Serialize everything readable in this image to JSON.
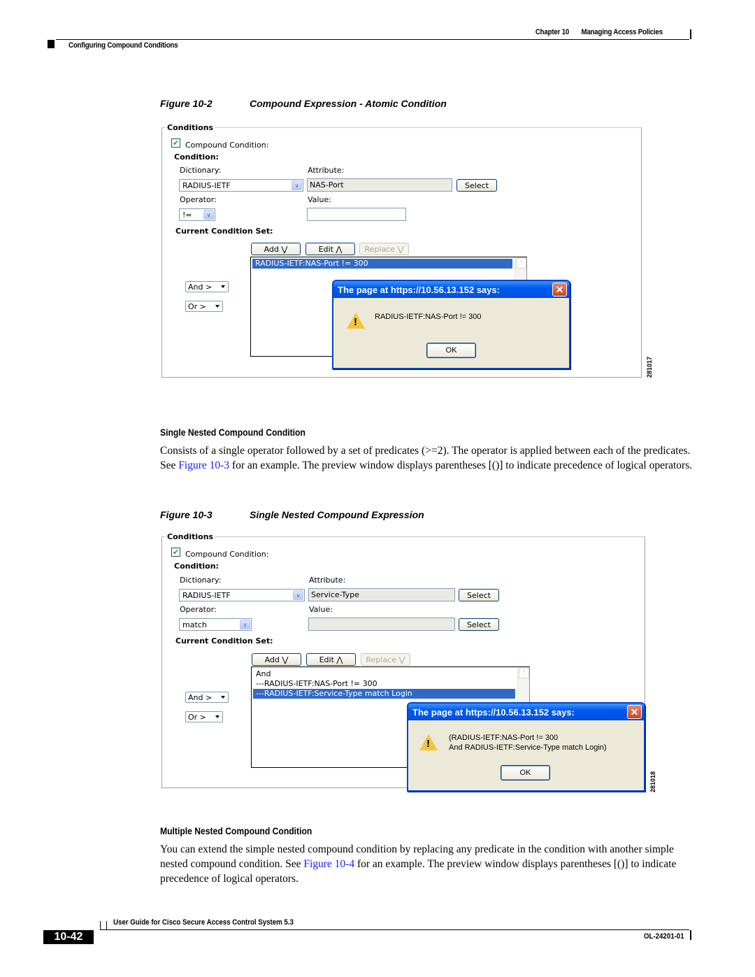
{
  "header": {
    "chapter": "Chapter 10",
    "chapter_title": "Managing Access Policies",
    "section": "Configuring Compound Conditions"
  },
  "figure2": {
    "number": "Figure 10-2",
    "title": "Compound Expression - Atomic Condition",
    "id": "281017",
    "ui": {
      "legend": "Conditions",
      "compound_checkbox_label": "Compound Condition:",
      "compound_checked": true,
      "condition_heading": "Condition:",
      "dictionary_label": "Dictionary:",
      "dictionary_value": "RADIUS-IETF",
      "attribute_label": "Attribute:",
      "attribute_value": "NAS-Port",
      "attribute_select_button": "Select",
      "operator_label": "Operator:",
      "operator_value": "!=",
      "value_label": "Value:",
      "value_value": "",
      "current_set_heading": "Current Condition Set:",
      "add_button": "Add ⋁",
      "edit_button": "Edit ⋀",
      "replace_button": "Replace ⋁",
      "list_items": [
        {
          "text": "RADIUS-IETF:NAS-Port != 300",
          "selected": true
        }
      ],
      "and_select": "And >",
      "or_select": "Or >",
      "dialog": {
        "title": "The page at https://10.56.13.152 says:",
        "message_lines": [
          "RADIUS-IETF:NAS-Port != 300"
        ],
        "ok": "OK"
      }
    }
  },
  "section1": {
    "heading": "Single Nested Compound Condition",
    "para_part1": "Consists of a single operator followed by a set of predicates (>=2). The operator is applied between each of the predicates. See ",
    "para_link": "Figure 10-3",
    "para_part2": " for an example. The preview window displays parentheses [()] to indicate precedence of logical operators."
  },
  "figure3": {
    "number": "Figure 10-3",
    "title": "Single Nested Compound Expression",
    "id": "281018",
    "ui": {
      "legend": "Conditions",
      "compound_checkbox_label": "Compound Condition:",
      "compound_checked": true,
      "condition_heading": "Condition:",
      "dictionary_label": "Dictionary:",
      "dictionary_value": "RADIUS-IETF",
      "attribute_label": "Attribute:",
      "attribute_value": "Service-Type",
      "attribute_select_button": "Select",
      "operator_label": "Operator:",
      "operator_value": "match",
      "value_label": "Value:",
      "value_value": "",
      "value_select_button": "Select",
      "current_set_heading": "Current Condition Set:",
      "add_button": "Add ⋁",
      "edit_button": "Edit ⋀",
      "replace_button": "Replace ⋁",
      "list_items": [
        {
          "text": "And",
          "selected": false
        },
        {
          "text": "---RADIUS-IETF:NAS-Port != 300",
          "selected": false
        },
        {
          "text": "---RADIUS-IETF:Service-Type match Login",
          "selected": true
        }
      ],
      "and_select": "And >",
      "or_select": "Or >",
      "dialog": {
        "title": "The page at https://10.56.13.152 says:",
        "message_lines": [
          "(RADIUS-IETF:NAS-Port != 300",
          "And RADIUS-IETF:Service-Type match Login)"
        ],
        "ok": "OK"
      }
    }
  },
  "section2": {
    "heading": "Multiple Nested Compound Condition",
    "para_part1": "You can extend the simple nested compound condition by replacing any predicate in the condition with another simple nested compound condition. See ",
    "para_link": "Figure 10-4",
    "para_part2": " for an example. The preview window displays parentheses [()] to indicate precedence of logical operators."
  },
  "footer": {
    "guide_title": "User Guide for Cisco Secure Access Control System 5.3",
    "page_number": "10-42",
    "doc_id": "OL-24201-01"
  },
  "icons": {
    "checkbox": "✔",
    "dropdown": "∨",
    "scroll_up": "˄",
    "close": "✕",
    "warning": "!"
  }
}
